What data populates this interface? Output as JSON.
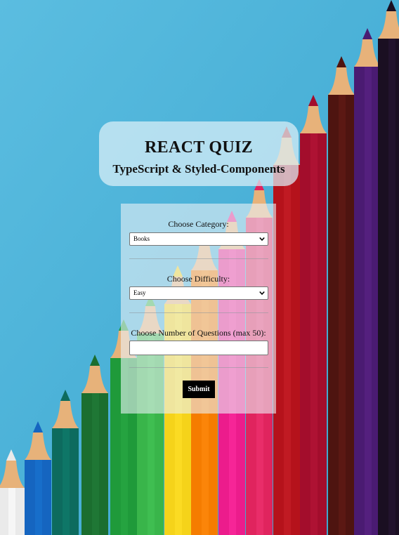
{
  "header": {
    "title": "REACT QUIZ",
    "subtitle": "TypeScript & Styled-Components"
  },
  "form": {
    "category": {
      "label": "Choose Category:",
      "selected": "Books"
    },
    "difficulty": {
      "label": "Choose Difficulty:",
      "selected": "Easy"
    },
    "questions": {
      "label": "Choose Number of Questions (max 50):",
      "value": "",
      "placeholder": ""
    },
    "submit_label": "Submit"
  },
  "colors": {
    "background": "#4fb3d6",
    "button": "#000000"
  }
}
